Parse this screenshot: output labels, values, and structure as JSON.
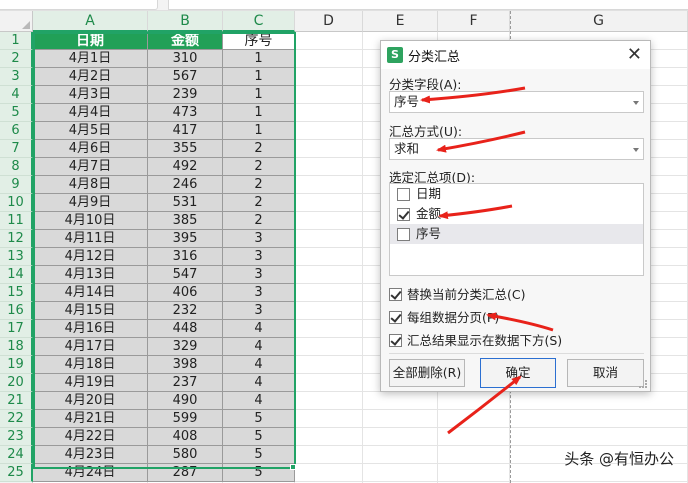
{
  "sheet": {
    "columns": [
      "A",
      "B",
      "C",
      "D",
      "E",
      "F",
      "G"
    ],
    "row_numbers": [
      "1",
      "2",
      "3",
      "4",
      "5",
      "6",
      "7",
      "8",
      "9",
      "10",
      "11",
      "12",
      "13",
      "14",
      "15",
      "16",
      "17",
      "18",
      "19",
      "20",
      "21",
      "22",
      "23",
      "24",
      "25",
      "26"
    ],
    "header": [
      "日期",
      "金额",
      "序号"
    ],
    "rows": [
      [
        "4月1日",
        "310",
        "1"
      ],
      [
        "4月2日",
        "567",
        "1"
      ],
      [
        "4月3日",
        "239",
        "1"
      ],
      [
        "4月4日",
        "473",
        "1"
      ],
      [
        "4月5日",
        "417",
        "1"
      ],
      [
        "4月6日",
        "355",
        "2"
      ],
      [
        "4月7日",
        "492",
        "2"
      ],
      [
        "4月8日",
        "246",
        "2"
      ],
      [
        "4月9日",
        "531",
        "2"
      ],
      [
        "4月10日",
        "385",
        "2"
      ],
      [
        "4月11日",
        "395",
        "3"
      ],
      [
        "4月12日",
        "316",
        "3"
      ],
      [
        "4月13日",
        "547",
        "3"
      ],
      [
        "4月14日",
        "406",
        "3"
      ],
      [
        "4月15日",
        "232",
        "3"
      ],
      [
        "4月16日",
        "448",
        "4"
      ],
      [
        "4月17日",
        "329",
        "4"
      ],
      [
        "4月18日",
        "398",
        "4"
      ],
      [
        "4月19日",
        "237",
        "4"
      ],
      [
        "4月20日",
        "490",
        "4"
      ],
      [
        "4月21日",
        "599",
        "5"
      ],
      [
        "4月22日",
        "408",
        "5"
      ],
      [
        "4月23日",
        "580",
        "5"
      ],
      [
        "4月24日",
        "287",
        "5"
      ]
    ],
    "header_color": "#21a057",
    "selection_color": "#21a366"
  },
  "dialog": {
    "logo": "S",
    "title": "分类汇总",
    "close": "✕",
    "group_field_label": "分类字段(A):",
    "group_field_value": "序号",
    "method_label": "汇总方式(U):",
    "method_value": "求和",
    "items_label": "选定汇总项(D):",
    "items": [
      {
        "label": "日期",
        "checked": false
      },
      {
        "label": "金额",
        "checked": true
      },
      {
        "label": "序号",
        "checked": false
      }
    ],
    "options": [
      {
        "label": "替换当前分类汇总(C)",
        "checked": true
      },
      {
        "label": "每组数据分页(P)",
        "checked": true
      },
      {
        "label": "汇总结果显示在数据下方(S)",
        "checked": true
      }
    ],
    "buttons": {
      "remove_all": "全部删除(R)",
      "ok": "确定",
      "cancel": "取消"
    }
  },
  "watermark": "头条 @有恒办公",
  "annotation_color": "#e8221a"
}
